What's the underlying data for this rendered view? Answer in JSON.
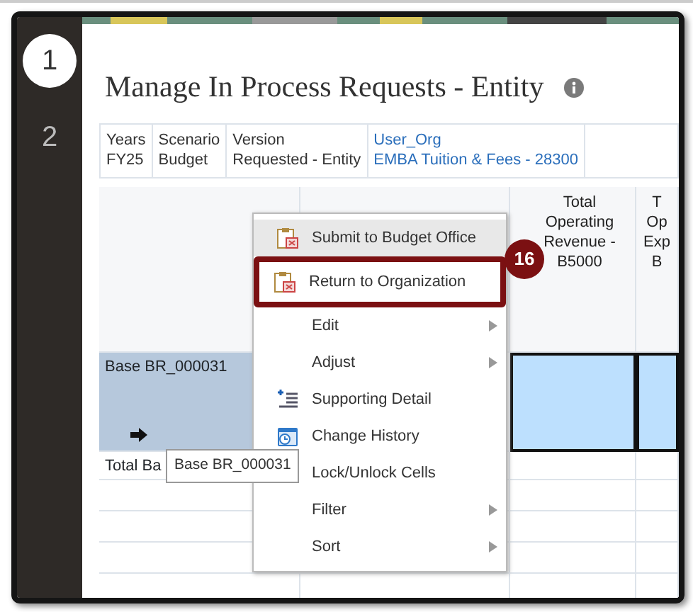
{
  "steps": [
    {
      "label": "1",
      "selected": true
    },
    {
      "label": "2",
      "selected": false
    }
  ],
  "title": "Manage In Process Requests - Entity",
  "pov": [
    {
      "label": "Years",
      "value": "FY25",
      "link": false
    },
    {
      "label": "Scenario",
      "value": "Budget",
      "link": false
    },
    {
      "label": "Version",
      "value": "Requested - Entity",
      "link": false
    },
    {
      "label": "User_Org",
      "value": "EMBA Tuition & Fees - 28300",
      "link": true
    }
  ],
  "grid": {
    "columns": [
      {
        "header_lines": [
          "Total",
          "Operating",
          "Revenue -",
          "B5000"
        ]
      },
      {
        "header_lines": [
          "T",
          "Op",
          "Exp",
          "B"
        ]
      }
    ],
    "rows": [
      {
        "label": "Base BR_000031",
        "selected": true,
        "marker": true
      },
      {
        "label": "Total Ba",
        "selected": false,
        "marker": false
      }
    ]
  },
  "menu": [
    {
      "label": "Submit to Budget Office",
      "kind": "clipboard",
      "submenu": false,
      "selected": true,
      "callout": false
    },
    {
      "label": "Return to Organization",
      "kind": "clipboard",
      "submenu": false,
      "selected": false,
      "callout": true
    },
    {
      "label": "Edit",
      "kind": "plain",
      "submenu": true,
      "selected": false,
      "callout": false
    },
    {
      "label": "Adjust",
      "kind": "plain",
      "submenu": true,
      "selected": false,
      "callout": false
    },
    {
      "label": "Supporting Detail",
      "kind": "detail",
      "submenu": false,
      "selected": false,
      "callout": false
    },
    {
      "label": "Change History",
      "kind": "history",
      "submenu": false,
      "selected": false,
      "callout": false
    },
    {
      "label": "Lock/Unlock Cells",
      "kind": "plain",
      "submenu": false,
      "selected": false,
      "callout": false
    },
    {
      "label": "Filter",
      "kind": "plain",
      "submenu": true,
      "selected": false,
      "callout": false
    },
    {
      "label": "Sort",
      "kind": "plain",
      "submenu": true,
      "selected": false,
      "callout": false
    }
  ],
  "callout": {
    "number": "16"
  },
  "tooltip": {
    "text": "Base BR_000031"
  }
}
